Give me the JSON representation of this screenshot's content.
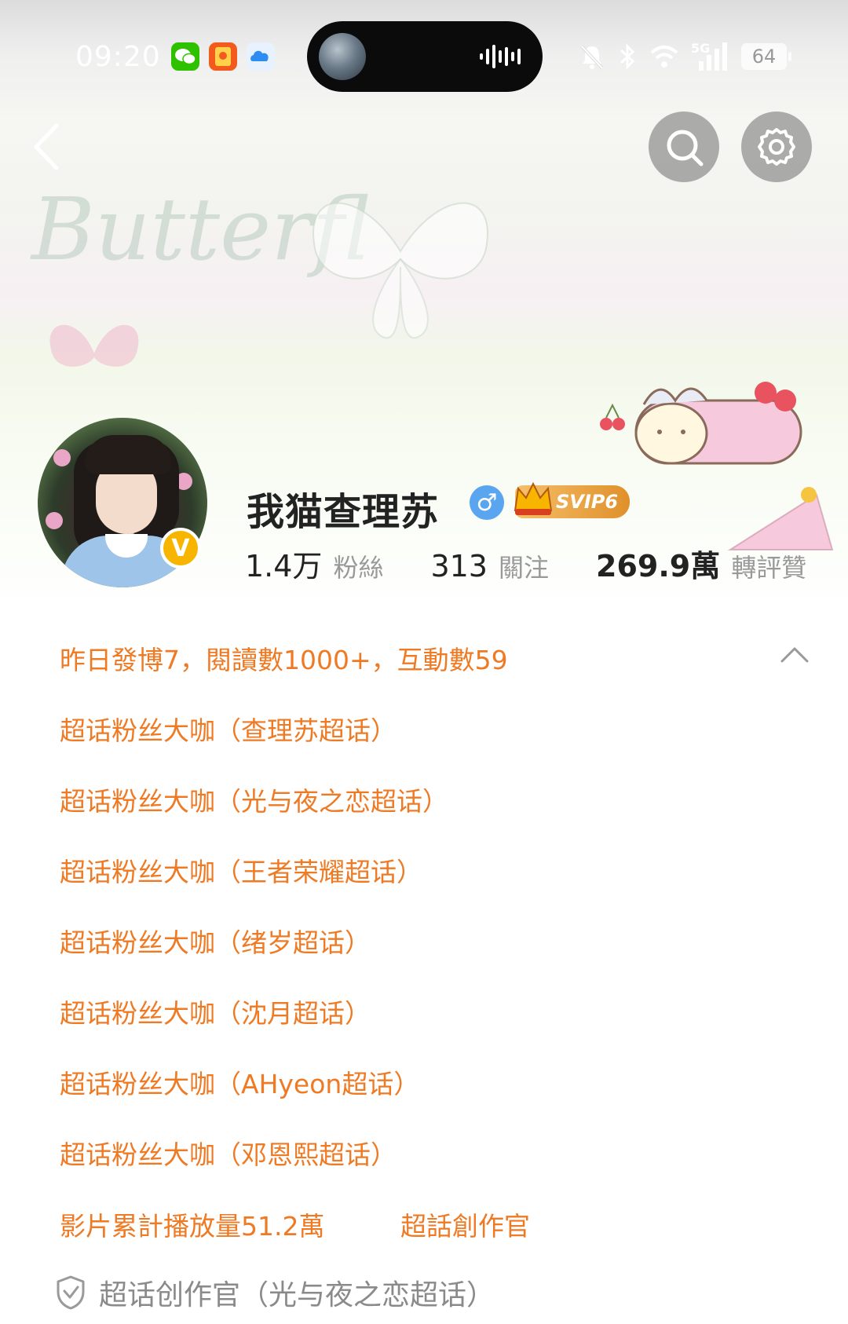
{
  "status_bar": {
    "time": "09:20",
    "app_icons": [
      "wechat-icon",
      "red-packet-icon",
      "cloud-app-icon"
    ],
    "network": "5G",
    "battery": "64"
  },
  "header": {
    "banner_script_text": "Butterfl"
  },
  "profile": {
    "username": "我猫查理苏",
    "gender": "♂",
    "verified_badge": "V",
    "svip_badge": "SVIP6",
    "stats": [
      {
        "value": "1.4万",
        "label": "粉絲"
      },
      {
        "value": "313",
        "label": "關注"
      },
      {
        "value": "269.9萬",
        "label": "轉評贊"
      }
    ]
  },
  "details": {
    "summary": "昨日發博7，閱讀數1000+，互動數59",
    "titles": [
      "超话粉丝大咖（查理苏超话）",
      "超话粉丝大咖（光与夜之恋超话）",
      "超话粉丝大咖（王者荣耀超话）",
      "超话粉丝大咖（绪岁超话）",
      "超话粉丝大咖（沈月超话）",
      "超话粉丝大咖（AHyeon超话）",
      "超话粉丝大咖（邓恩熙超话）"
    ],
    "video_views": "影片累計播放量51.2萬",
    "creator_title": "超話創作官",
    "footer": "超话创作官（光与夜之恋超话）"
  },
  "colors": {
    "accent_orange": "#ef7a24",
    "svip_gold": "#e0902a",
    "verified_yellow": "#f7b500",
    "gender_blue": "#5aa5f0"
  }
}
